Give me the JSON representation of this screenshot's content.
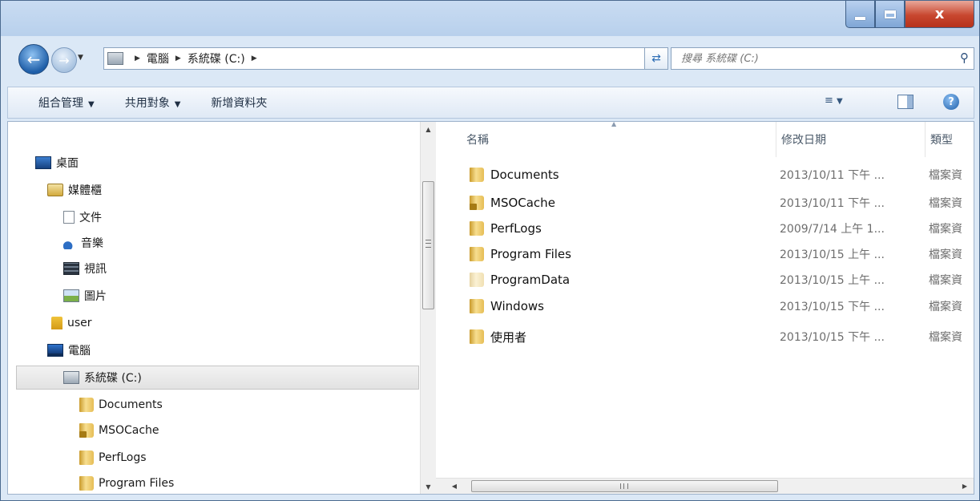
{
  "window": {
    "controls": {
      "close": "x"
    }
  },
  "navigation": {
    "breadcrumb": [
      "電腦",
      "系統碟 (C:)"
    ],
    "search_placeholder": "搜尋 系統碟 (C:)"
  },
  "toolbar": {
    "organize": "組合管理",
    "share_with": "共用對象",
    "new_folder": "新增資料夾",
    "help": "?"
  },
  "nav_tree": [
    {
      "label": "桌面",
      "icon": "desktop-icon"
    },
    {
      "label": "媒體櫃",
      "icon": "library-icon"
    },
    {
      "label": "文件",
      "icon": "document-icon"
    },
    {
      "label": "音樂",
      "icon": "music-icon"
    },
    {
      "label": "視訊",
      "icon": "video-icon"
    },
    {
      "label": "圖片",
      "icon": "picture-icon"
    },
    {
      "label": "user",
      "icon": "user-icon"
    },
    {
      "label": "電腦",
      "icon": "computer-icon"
    },
    {
      "label": "系統碟 (C:)",
      "icon": "drive-icon",
      "selected": true
    },
    {
      "label": "Documents",
      "icon": "folder-icon"
    },
    {
      "label": "MSOCache",
      "icon": "locked-folder-icon"
    },
    {
      "label": "PerfLogs",
      "icon": "folder-icon"
    },
    {
      "label": "Program Files",
      "icon": "folder-icon"
    }
  ],
  "file_list": {
    "columns": {
      "name": "名稱",
      "date_modified": "修改日期",
      "type": "類型"
    },
    "rows": [
      {
        "name": "Documents",
        "date": "2013/10/11 下午 ...",
        "type": "檔案資",
        "icon": "folder-icon"
      },
      {
        "name": "MSOCache",
        "date": "2013/10/11 下午 ...",
        "type": "檔案資",
        "icon": "locked-folder-icon"
      },
      {
        "name": "PerfLogs",
        "date": "2009/7/14 上午 1...",
        "type": "檔案資",
        "icon": "folder-icon"
      },
      {
        "name": "Program Files",
        "date": "2013/10/15 上午 ...",
        "type": "檔案資",
        "icon": "folder-icon"
      },
      {
        "name": "ProgramData",
        "date": "2013/10/15 上午 ...",
        "type": "檔案資",
        "icon": "hidden-folder-icon"
      },
      {
        "name": "Windows",
        "date": "2013/10/15 下午 ...",
        "type": "檔案資",
        "icon": "folder-icon"
      },
      {
        "name": "使用者",
        "date": "2013/10/15 下午 ...",
        "type": "檔案資",
        "icon": "folder-icon"
      }
    ]
  },
  "colors": {
    "window_frame": "#b8d0ec",
    "close_button": "#c8472f",
    "selection": "#e2e2e2"
  }
}
